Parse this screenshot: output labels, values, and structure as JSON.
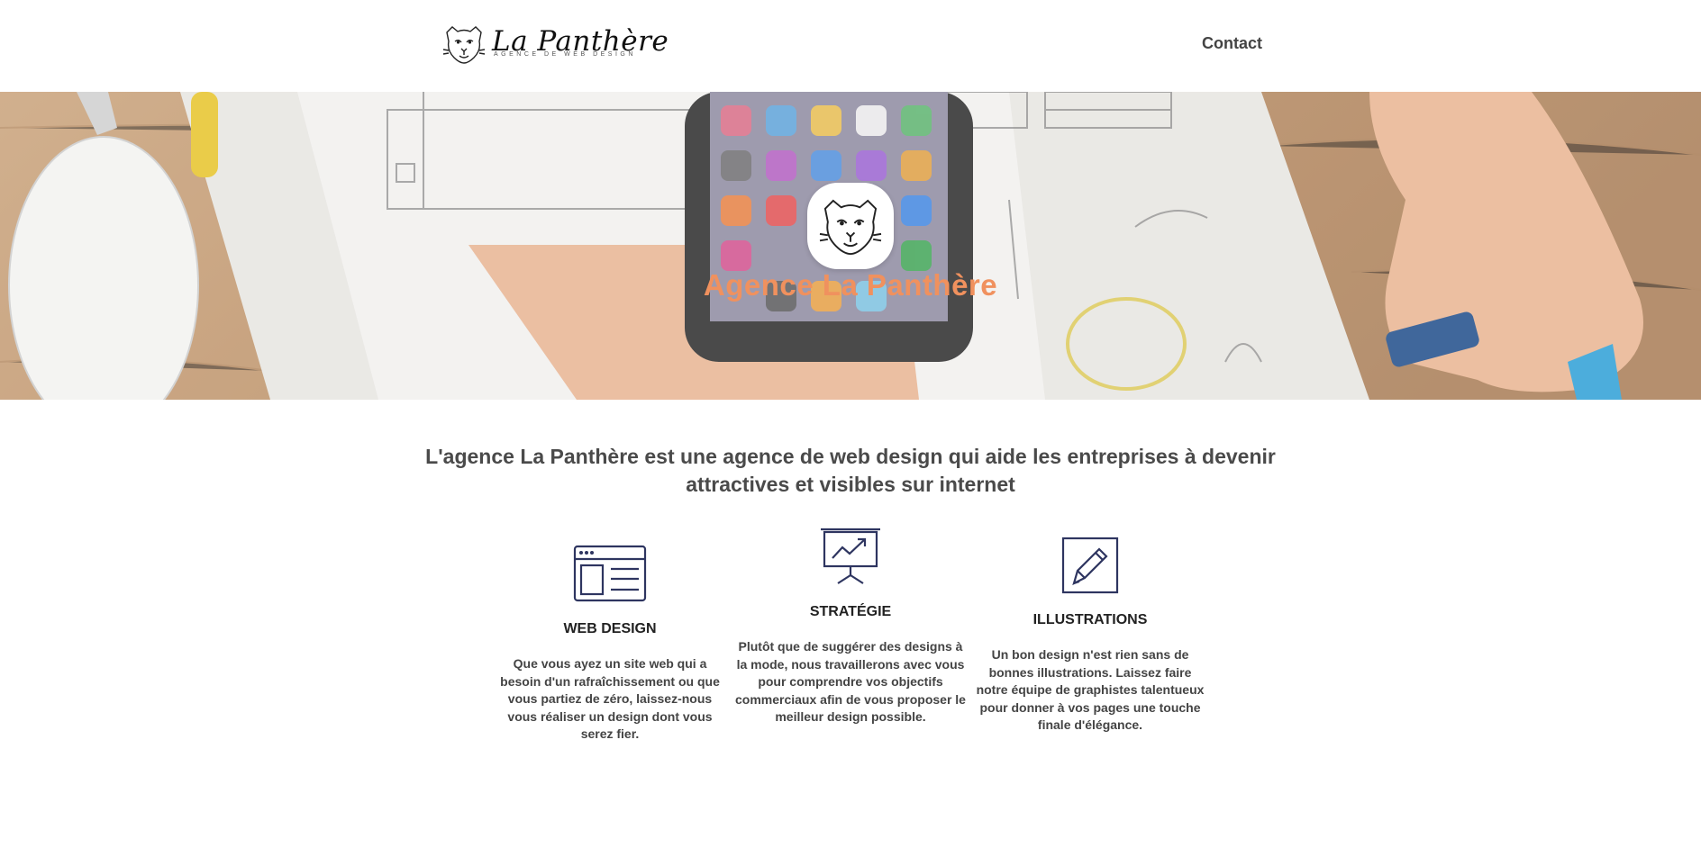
{
  "header": {
    "logo": {
      "name": "La Panthère",
      "tagline": "AGENCE DE WEB DESIGN",
      "icon": "panther-head-icon"
    },
    "nav": {
      "contact_label": "Contact"
    }
  },
  "hero": {
    "badge_icon": "panther-head-icon",
    "title": "Agence La Panthère",
    "background": "desk-with-phone-and-sketches-photo"
  },
  "intro": {
    "text": "L'agence La Panthère est une agence de web design qui aide les entreprises à devenir attractives et visibles sur internet"
  },
  "services": [
    {
      "icon": "browser-window-icon",
      "title": "WEB DESIGN",
      "text": "Que vous ayez un site web qui a besoin d'un rafraîchissement ou que vous partiez de zéro, laissez-nous vous réaliser un design dont vous serez fier."
    },
    {
      "icon": "presentation-chart-icon",
      "title": "STRATÉGIE",
      "text": "Plutôt que de suggérer des designs à la mode, nous travaillerons avec vous pour comprendre vos objectifs commerciaux afin de vous proposer le meilleur design possible."
    },
    {
      "icon": "pencil-icon",
      "title": "ILLUSTRATIONS",
      "text": "Un bon design n'est rien sans de bonnes illustrations. Laissez faire notre équipe de graphistes talentueux pour donner à vos pages une touche finale d'élégance."
    }
  ],
  "colors": {
    "accent": "#f0915e",
    "icon": "#2e3560",
    "text": "#444444"
  }
}
